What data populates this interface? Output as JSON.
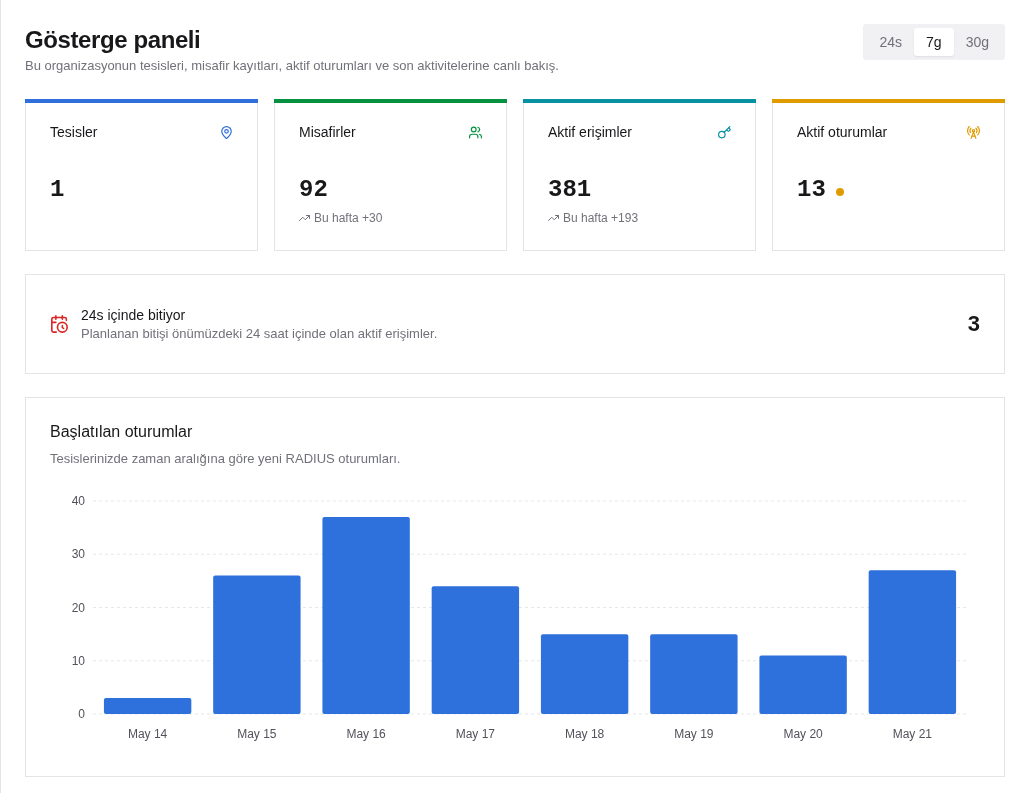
{
  "header": {
    "title": "Gösterge paneli",
    "subtitle": "Bu organizasyonun tesisleri, misafir kayıtları, aktif oturumları ve son aktivitelerine canlı bakış.",
    "range_tabs": [
      {
        "label": "24s",
        "selected": false
      },
      {
        "label": "7g",
        "selected": true
      },
      {
        "label": "30g",
        "selected": false
      }
    ]
  },
  "stats": [
    {
      "label": "Tesisler",
      "value": "1",
      "color": "#2e6fdc",
      "live": false
    },
    {
      "label": "Misafirler",
      "value": "92",
      "trend": "Bu hafta +30",
      "color": "#05913f",
      "live": false
    },
    {
      "label": "Aktif erişimler",
      "value": "381",
      "trend": "Bu hafta +193",
      "color": "#0891a3",
      "live": false
    },
    {
      "label": "Aktif oturumlar",
      "value": "13",
      "color": "#e09b00",
      "live": true
    }
  ],
  "expiring": {
    "title": "24s içinde bitiyor",
    "description": "Planlanan bitişi önümüzdeki 24 saat içinde olan aktif erişimler.",
    "count": "3"
  },
  "sessions_chart": {
    "title": "Başlatılan oturumlar",
    "description": "Tesislerinizde zaman aralığına göre yeni RADIUS oturumları.",
    "chart_data": {
      "type": "bar",
      "categories": [
        "May 14",
        "May 15",
        "May 16",
        "May 17",
        "May 18",
        "May 19",
        "May 20",
        "May 21"
      ],
      "values": [
        3,
        26,
        37,
        24,
        15,
        15,
        11,
        27
      ],
      "ylim": [
        0,
        40
      ],
      "yticks": [
        0,
        10,
        20,
        30,
        40
      ],
      "grid": true
    }
  }
}
